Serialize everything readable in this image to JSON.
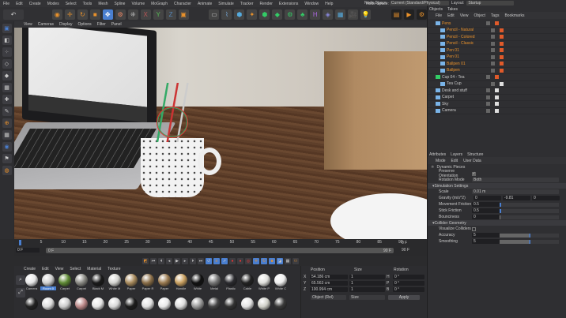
{
  "menu": [
    "File",
    "Edit",
    "Create",
    "Modes",
    "Select",
    "Tools",
    "Mesh",
    "Spline",
    "Volume",
    "MoGraph",
    "Character",
    "Animate",
    "Simulate",
    "Tracker",
    "Render",
    "Extensions",
    "Window",
    "Help"
  ],
  "node_space": {
    "label": "Node Space:",
    "value": "Current (Standard/Physical)",
    "layout_label": "Layout:",
    "layout_value": "Startup"
  },
  "viewport": {
    "menu": [
      "View",
      "Cameras",
      "Display",
      "Options",
      "Filter",
      "Panel"
    ]
  },
  "objects": {
    "tabs": [
      "Objects",
      "Takes"
    ],
    "menu": [
      "File",
      "Edit",
      "View",
      "Object",
      "Tags",
      "Bookmarks"
    ],
    "items": [
      {
        "name": "Pens",
        "indent": 0,
        "orange": true
      },
      {
        "name": "Pencil - Natural",
        "indent": 1,
        "orange": true
      },
      {
        "name": "Pencil - Colored",
        "indent": 1,
        "orange": true
      },
      {
        "name": "Pencil - Classic",
        "indent": 1,
        "orange": true
      },
      {
        "name": "Pen 01",
        "indent": 1,
        "orange": true
      },
      {
        "name": "Pen 01",
        "indent": 1,
        "orange": true
      },
      {
        "name": "Ballpen 01",
        "indent": 1,
        "orange": true
      },
      {
        "name": "Ballpen",
        "indent": 1,
        "orange": true
      },
      {
        "name": "Cup 04 - Tea",
        "indent": 0,
        "orange": false
      },
      {
        "name": "Tea Cup",
        "indent": 1,
        "orange": false
      },
      {
        "name": "Desk and stuff",
        "indent": 0,
        "orange": false
      },
      {
        "name": "Carpet",
        "indent": 0,
        "orange": false
      },
      {
        "name": "Sky",
        "indent": 0,
        "orange": false
      },
      {
        "name": "Camera",
        "indent": 0,
        "orange": false
      }
    ]
  },
  "attributes": {
    "tabs": [
      "Attributes",
      "Layers",
      "Structure"
    ],
    "menu": [
      "Mode",
      "Edit",
      "User Data"
    ],
    "object_name": "Dynamic Pieces",
    "preserve_orientation": {
      "label": "Preserve Orientation",
      "checked": true
    },
    "rotation_mode": {
      "label": "Rotation Mode",
      "value": "Both"
    },
    "simulation_header": "Simulation Settings",
    "scale": {
      "label": "Scale",
      "value": "0.01 m"
    },
    "gravity": {
      "label": "Gravity (m/s^2)",
      "x": "0",
      "y": "-9.81",
      "z": "0"
    },
    "movement_friction": {
      "label": "Movement Friction",
      "value": "0.5"
    },
    "stick_friction": {
      "label": "Stick Friction",
      "value": "0.5"
    },
    "bounciness": {
      "label": "Bounciness",
      "value": "0"
    },
    "collider_header": "Collider Geometry",
    "visualize": {
      "label": "Visualize Colliders",
      "checked": false
    },
    "accuracy": {
      "label": "Accuracy",
      "value": "5"
    },
    "smoothing": {
      "label": "Smoothing",
      "value": "5"
    }
  },
  "timeline": {
    "ticks": [
      "0",
      "5",
      "10",
      "15",
      "20",
      "25",
      "30",
      "35",
      "40",
      "45",
      "50",
      "55",
      "60",
      "65",
      "70",
      "75",
      "80",
      "85",
      "90"
    ],
    "current": "0 F",
    "start": "0 F",
    "start2": "0 F",
    "end": "90 F",
    "end2": "90 F"
  },
  "materials": {
    "menu": [
      "Create",
      "Edit",
      "View",
      "Select",
      "Material",
      "Texture"
    ],
    "row1": [
      {
        "n": "Camera",
        "c": "#e8e8e8"
      },
      {
        "n": "Room 0",
        "c": "#cfcfcf"
      },
      {
        "n": "Carpet",
        "c": "#5f8a35"
      },
      {
        "n": "Carpet",
        "c": "#8a8a84"
      },
      {
        "n": "Black M",
        "c": "#1a1a1a"
      },
      {
        "n": "White M",
        "c": "#d4d4d0"
      },
      {
        "n": "Paper",
        "c": "#a88a5c"
      },
      {
        "n": "Paper R",
        "c": "#8a6e48"
      },
      {
        "n": "Paper",
        "c": "#9a7a50"
      },
      {
        "n": "Handle",
        "c": "#c9a060"
      },
      {
        "n": "White",
        "c": "#111"
      },
      {
        "n": "Metal",
        "c": "#777"
      },
      {
        "n": "Plastic",
        "c": "#2a2a2e"
      },
      {
        "n": "Cable",
        "c": "#222"
      },
      {
        "n": "White P",
        "c": "#e0e0dc"
      },
      {
        "n": "White C",
        "c": "#efefef"
      }
    ],
    "row2": [
      "#222",
      "#ddd",
      "#ccc",
      "#b88",
      "#e6e6e6",
      "#d8d8d8",
      "#1c1c1c",
      "#e2e2e2",
      "#e8e8e8",
      "#dcdcdc",
      "#999",
      "#444",
      "#333",
      "#e4e4e4",
      "#d0d0c8",
      "#3a3a3a"
    ]
  },
  "coordinates": {
    "headers": [
      "Position",
      "Size",
      "Rotation"
    ],
    "rows": [
      {
        "axis": "X",
        "pos": "54.186 cm",
        "size": "1",
        "rax": "H",
        "rot": "0 °"
      },
      {
        "axis": "Y",
        "pos": "65.563 cm",
        "size": "1",
        "rax": "P",
        "rot": "0 °"
      },
      {
        "axis": "Z",
        "pos": "100.994 cm",
        "size": "1",
        "rax": "B",
        "rot": "0 °"
      }
    ],
    "mode": "Object (Rel)",
    "size_mode": "Size",
    "apply": "Apply"
  },
  "colors": {
    "accent": "#e8912b",
    "selection": "#4a7fd0"
  }
}
